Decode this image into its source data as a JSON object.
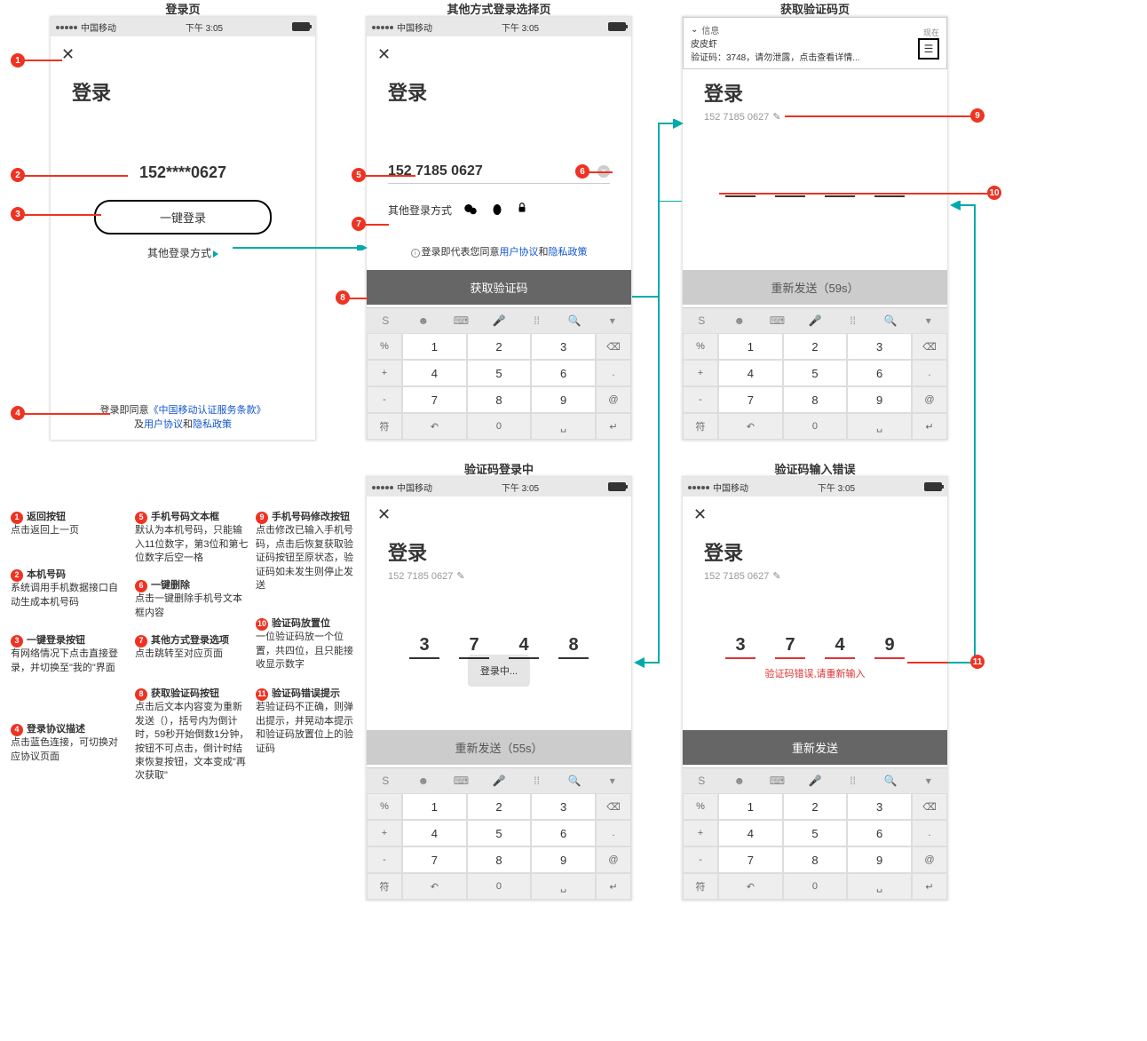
{
  "status_bar": {
    "carrier": "中国移动",
    "time": "下午 3:05"
  },
  "screens": {
    "login": {
      "label": "登录页",
      "title": "登录",
      "masked_phone": "152****0627",
      "one_key": "一键登录",
      "other_login": "其他登录方式",
      "agree_prefix": "登录即同意",
      "agree_link1": "《中国移动认证服务条款》",
      "agree_mid": "及",
      "agree_link2": "用户协议",
      "agree_and": "和",
      "agree_link3": "隐私政策"
    },
    "other": {
      "label": "其他方式登录选择页",
      "title": "登录",
      "phone": "152 7185 0627",
      "other_login": "其他登录方式",
      "agree_prefix": "登录即代表您同意",
      "agree_link1": "用户协议",
      "agree_and": "和",
      "agree_link2": "隐私政策",
      "get_code": "获取验证码"
    },
    "get_code": {
      "label": "获取验证码页",
      "notif_app": "信息",
      "notif_now": "现在",
      "notif_from": "皮皮虾",
      "notif_text": "验证码：3748，请勿泄露，点击查看详情...",
      "title": "登录",
      "phone_sub": "152 7185 0627",
      "resend": "重新发送（59s）"
    },
    "verifying": {
      "label": "验证码登录中",
      "title": "登录",
      "phone_sub": "152 7185 0627",
      "codes": [
        "3",
        "7",
        "4",
        "8"
      ],
      "loading": "登录中...",
      "resend": "重新发送（55s）"
    },
    "error": {
      "label": "验证码输入错误",
      "title": "登录",
      "phone_sub": "152 7185 0627",
      "codes": [
        "3",
        "7",
        "4",
        "9"
      ],
      "err": "验证码错误,请重新输入",
      "resend": "重新发送"
    }
  },
  "keypad": {
    "top_row": [
      "S",
      "☻",
      "⌨",
      "🎤",
      "⁞⁞",
      "🔍",
      "▾"
    ],
    "rows": [
      {
        "side_l": "%",
        "k1": "1",
        "k2": "2",
        "k3": "3",
        "side_r": "⌫"
      },
      {
        "side_l": "+",
        "k1": "4",
        "k2": "5",
        "k3": "6",
        "side_r": "."
      },
      {
        "side_l": "-",
        "k1": "7",
        "k2": "8",
        "k3": "9",
        "side_r": "@"
      },
      {
        "side_l": "*",
        "k1": "",
        "k2": "",
        "k3": "",
        "side_r": ""
      }
    ],
    "bottom": {
      "left": "符",
      "b1": "↶",
      "b2": "0",
      "b3": "␣",
      "right": "↵"
    }
  },
  "annotations": {
    "1": {
      "title": "返回按钮",
      "desc": "点击返回上一页"
    },
    "2": {
      "title": "本机号码",
      "desc": "系统调用手机数据接口自动生成本机号码"
    },
    "3": {
      "title": "一键登录按钮",
      "desc": "有网络情况下点击直接登录，并切换至\"我的\"界面"
    },
    "4": {
      "title": "登录协议描述",
      "desc": "点击蓝色连接，可切换对应协议页面"
    },
    "5": {
      "title": "手机号码文本框",
      "desc": "默认为本机号码，只能输入11位数字，第3位和第七位数字后空一格"
    },
    "6": {
      "title": "一键删除",
      "desc": "点击一键删除手机号文本框内容"
    },
    "7": {
      "title": "其他方式登录选项",
      "desc": "点击跳转至对应页面"
    },
    "8": {
      "title": "获取验证码按钮",
      "desc": "点击后文本内容变为重新发送（），括号内为倒计时，59秒开始倒数1分钟，按钮不可点击，倒计时结束恢复按钮，文本变成\"再次获取\""
    },
    "9": {
      "title": "手机号码修改按钮",
      "desc": "点击修改已输入手机号码，点击后恢复获取验证码按钮至原状态，验证码如未发生则停止发送"
    },
    "10": {
      "title": "验证码放置位",
      "desc": "一位验证码放一个位置，共四位，且只能接收显示数字"
    },
    "11": {
      "title": "验证码错误提示",
      "desc": "若验证码不正确，则弹出提示，并晃动本提示和验证码放置位上的验证码"
    }
  }
}
